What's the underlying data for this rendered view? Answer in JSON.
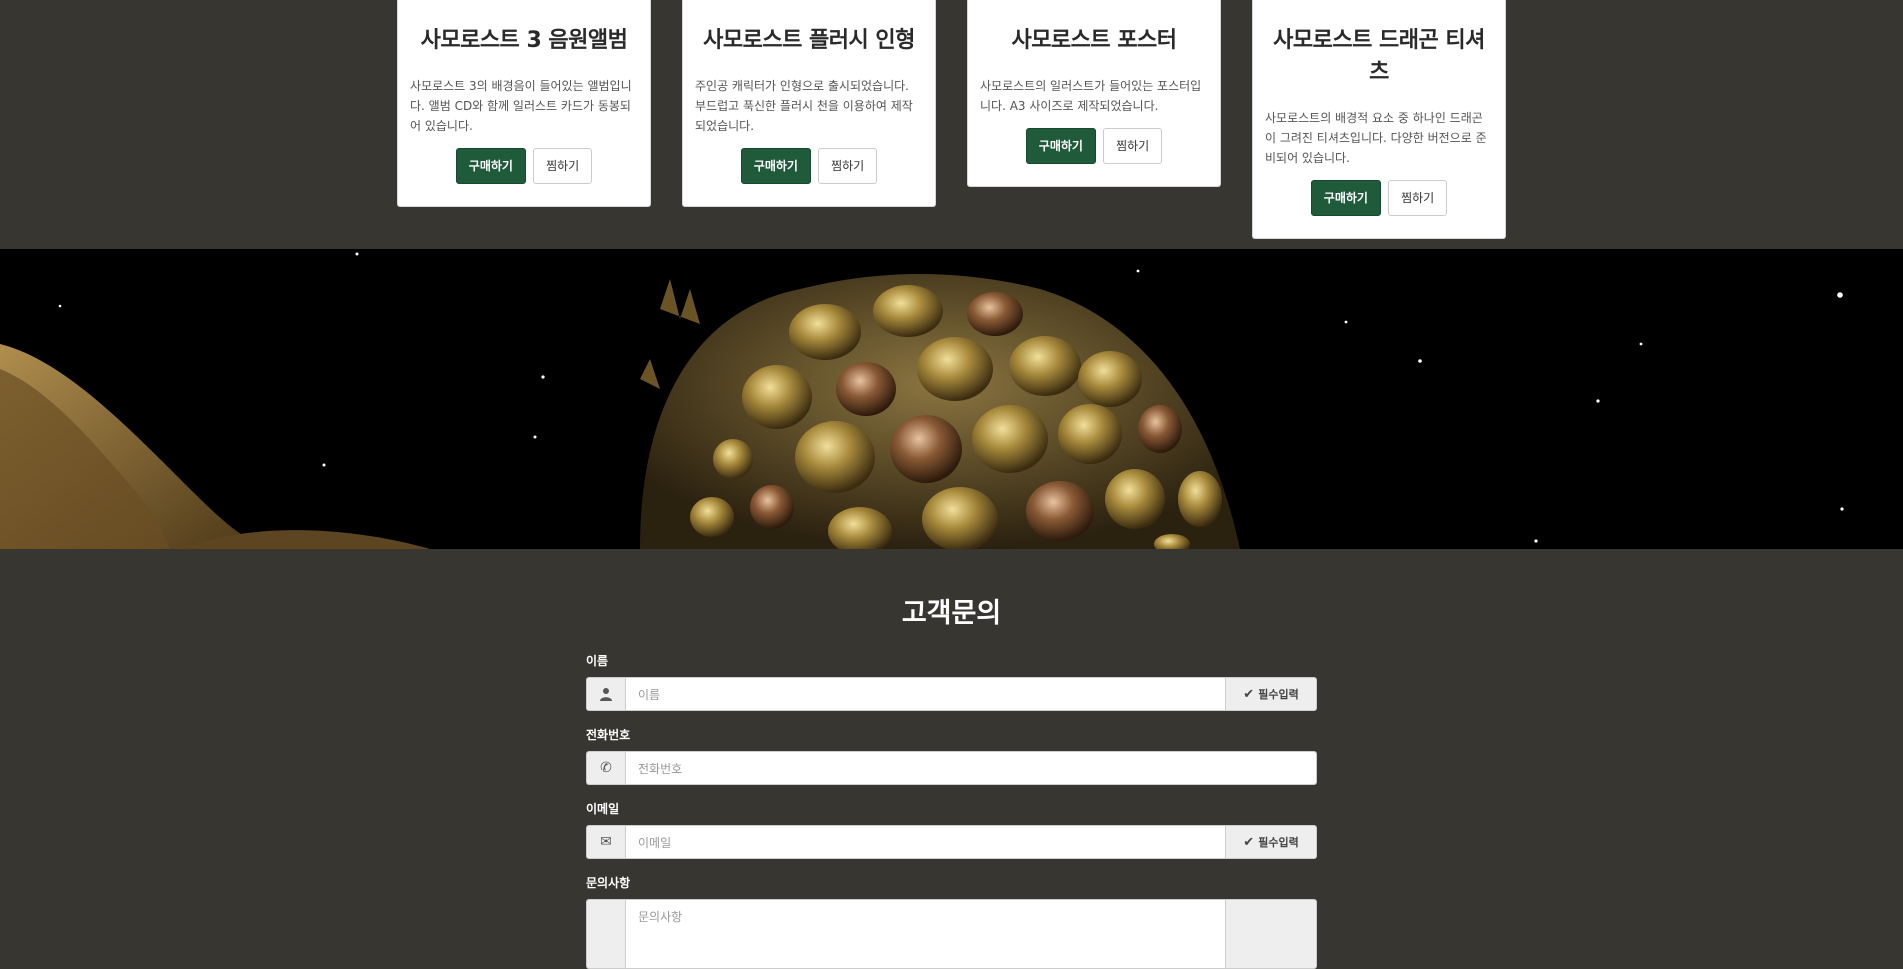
{
  "products": [
    {
      "title": "사모로스트 3 음원앨범",
      "desc": "사모로스트 3의 배경음이 들어있는 앨범입니다. 앨범 CD와 함께 일러스트 카드가 동봉되어 있습니다.",
      "buy": "구매하기",
      "like": "찜하기"
    },
    {
      "title": "사모로스트 플러시 인형",
      "desc": "주인공 캐릭터가 인형으로 출시되었습니다. 부드럽고 푹신한 플러시 천을 이용하여 제작되었습니다.",
      "buy": "구매하기",
      "like": "찜하기"
    },
    {
      "title": "사모로스트 포스터",
      "desc": "사모로스트의 일러스트가 들어있는 포스터입니다. A3 사이즈로 제작되었습니다.",
      "buy": "구매하기",
      "like": "찜하기"
    },
    {
      "title": "사모로스트 드래곤 티셔츠",
      "desc": "사모로스트의 배경적 요소 중 하나인 드래곤이 그려진 티셔츠입니다. 다양한 버전으로 준비되어 있습니다.",
      "buy": "구매하기",
      "like": "찜하기"
    }
  ],
  "contact": {
    "title": "고객문의",
    "name": {
      "label": "이름",
      "placeholder": "이름",
      "required": "필수입력"
    },
    "phone": {
      "label": "전화번호",
      "placeholder": "전화번호"
    },
    "email": {
      "label": "이메일",
      "placeholder": "이메일",
      "required": "필수입력"
    },
    "message": {
      "label": "문의사항",
      "placeholder": "문의사항"
    }
  },
  "icons": {
    "name": "user-icon",
    "phone": "phone-icon",
    "email": "envelope-icon",
    "required": "check-icon"
  },
  "colors": {
    "background": "#383631",
    "buy_button": "#1f5a3a"
  }
}
